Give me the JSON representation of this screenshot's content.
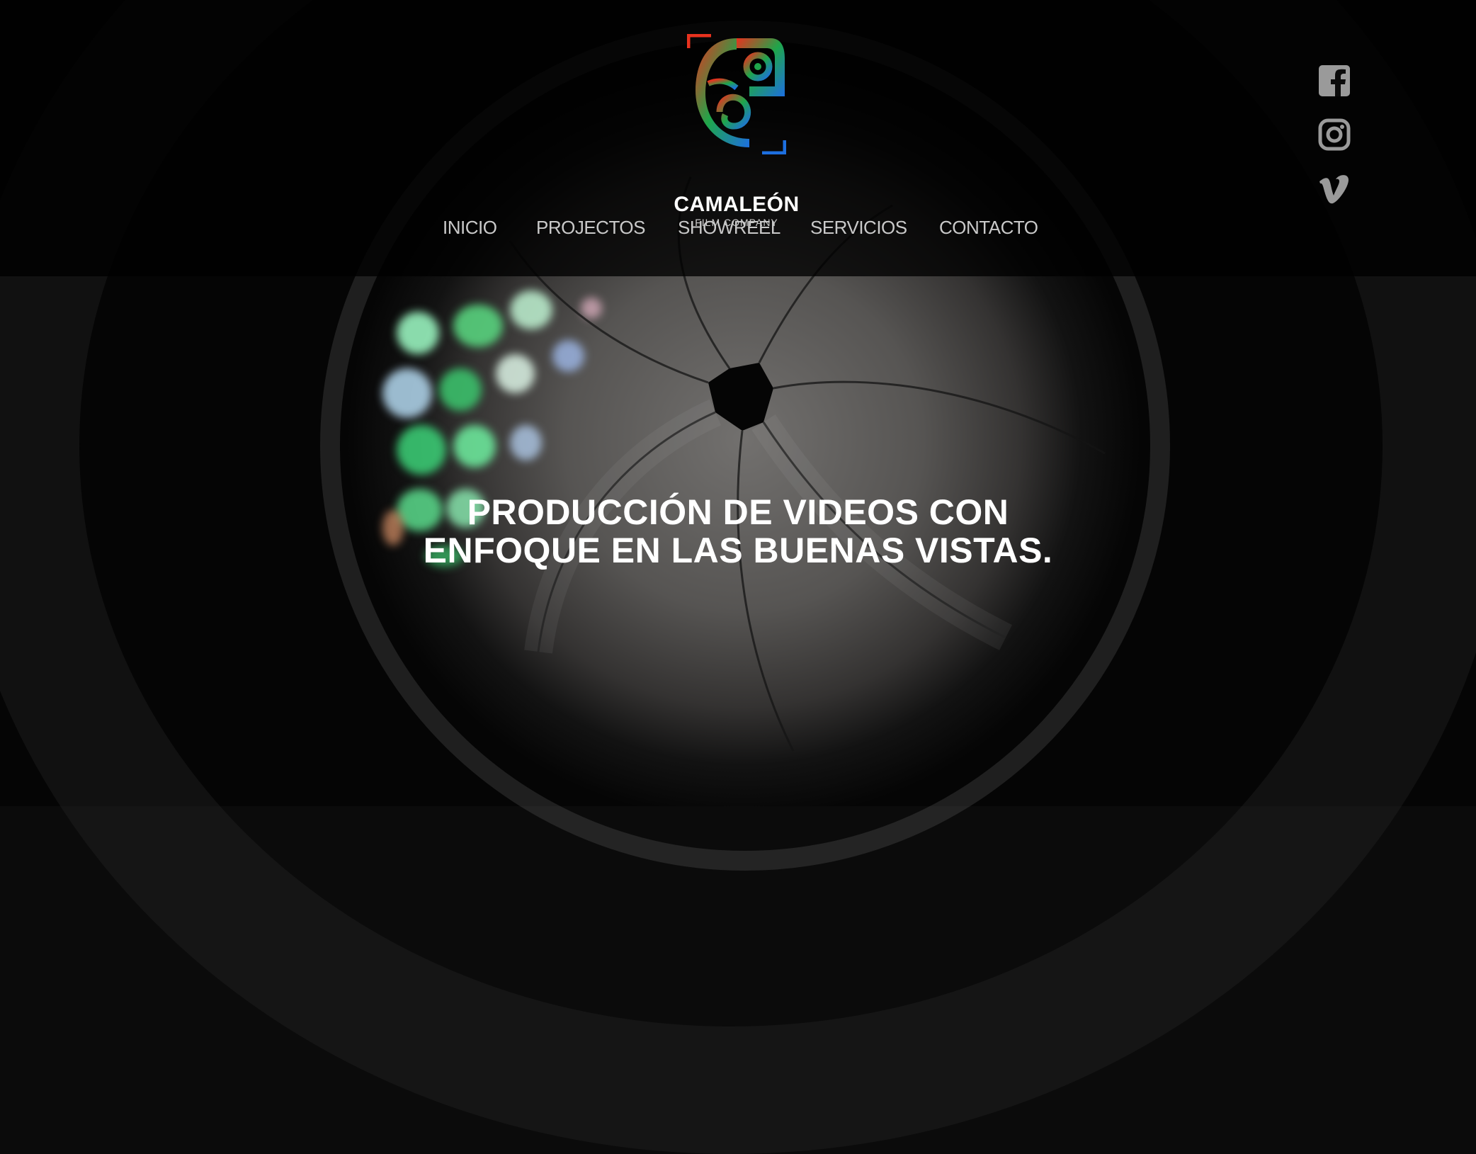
{
  "brand": {
    "name": "CAMALEÓN",
    "tagline": "FILM COMPANY",
    "colors": {
      "red": "#e8321e",
      "green": "#1fa64a",
      "blue": "#1d6fe0"
    }
  },
  "nav": {
    "items": [
      {
        "label": "INICIO"
      },
      {
        "label": "PROJECTOS"
      },
      {
        "label": "SHOWREEL"
      },
      {
        "label": "SERVICIOS"
      },
      {
        "label": "CONTACTO"
      }
    ]
  },
  "social": {
    "icons": [
      "facebook-icon",
      "instagram-icon",
      "vimeo-icon"
    ],
    "color": "#9a9a9a"
  },
  "hero": {
    "headline_line1": "PRODUCCIÓN DE VIDEOS CON",
    "headline_line2": "ENFOQUE EN LAS BUENAS VISTAS."
  }
}
